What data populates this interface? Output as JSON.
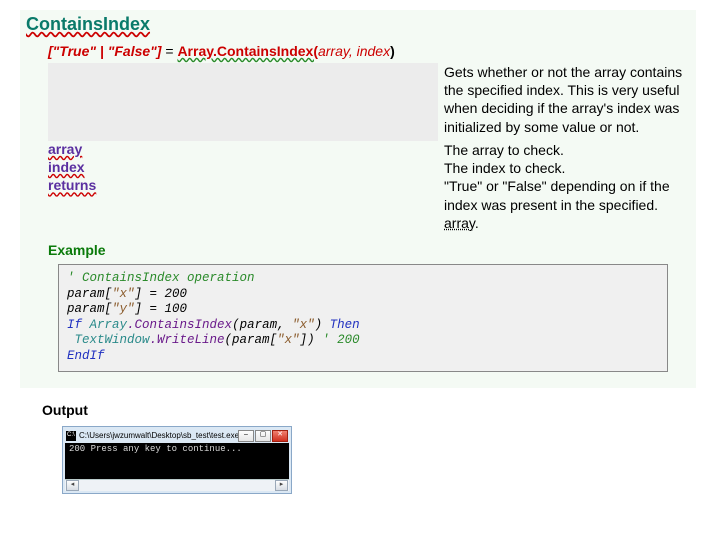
{
  "heading": "ContainsIndex",
  "signature": {
    "return": "[\"True\" | \"False\"]",
    "equals": " = ",
    "prefix": "Array.ContainsIndex(",
    "arg1": "array",
    "comma": ",  ",
    "arg2": "index",
    "close": ")"
  },
  "description": "Gets whether or not the array contains the specified index. This is very useful when deciding if the array's index was initialized by some value or not.",
  "params": [
    {
      "name": "array",
      "desc": "The array to check."
    },
    {
      "name": "index",
      "desc": "The index to check."
    },
    {
      "name": "returns",
      "desc_a": "\"True\" or \"False\" depending on if the index was present in the specified",
      "desc_b": "array"
    }
  ],
  "exampleLabel": "Example",
  "code": {
    "l1": "' ContainsIndex operation",
    "l2a": "param[",
    "l2b": "\"x\"",
    "l2c": "] = 200",
    "l3a": "param[",
    "l3b": "\"y\"",
    "l3c": "] = 100",
    "l4a": "If",
    "l4b": " Array",
    "l4c": ".ContainsIndex",
    "l4d": "(param, ",
    "l4e": "\"x\"",
    "l4f": ") ",
    "l4g": "Then",
    "l5a": " TextWindow",
    "l5b": ".WriteLine",
    "l5c": "(param[",
    "l5d": "\"x\"",
    "l5e": "]) ",
    "l5f": "' 200",
    "l6": "EndIf"
  },
  "outputLabel": "Output",
  "console": {
    "titlePath": "C:\\Users\\jwzumwalt\\Desktop\\sb_test\\test.exe",
    "line1": "200",
    "line2": "Press any key to continue..."
  }
}
